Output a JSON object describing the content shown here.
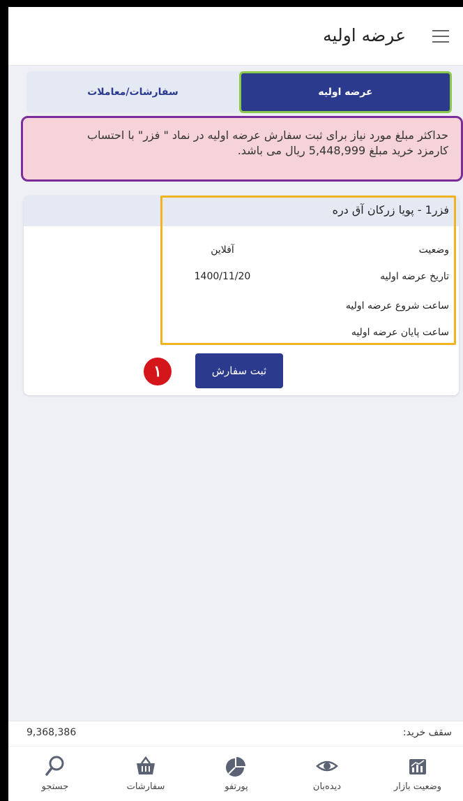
{
  "header": {
    "title": "عرضه اولیه",
    "menu_icon": "hamburger-menu-icon"
  },
  "tabs": [
    {
      "label": "عرضه اولیه",
      "active": true
    },
    {
      "label": "سفارشات/معاملات",
      "active": false
    }
  ],
  "alert": {
    "line1": "حداکثر مبلغ مورد نیاز برای ثبت سفارش عرضه اولیه در نماد \" فزر\" با احتساب",
    "line2": "کارمزد خرید مبلغ 5,448,999 ریال می باشد."
  },
  "offering": {
    "symbol_name": "فزر1  -  پویا زرکان آق دره",
    "rows": [
      {
        "label": "وضعیت",
        "value": "آفلاین"
      },
      {
        "label": "تاریخ عرضه اولیه",
        "value": "1400/11/20"
      },
      {
        "label": "ساعت شروع عرضه اولیه",
        "value": ""
      },
      {
        "label": "ساعت پایان عرضه اولیه",
        "value": ""
      }
    ],
    "submit_label": "ثبت سفارش",
    "step_badge": "١"
  },
  "buy_cap": {
    "label": "سقف خرید:",
    "value": "9,368,386"
  },
  "bottom_nav": [
    {
      "label": "وضعیت بازار",
      "icon": "market-chart-icon"
    },
    {
      "label": "دیده‌بان",
      "icon": "eye-icon"
    },
    {
      "label": "پورتفو",
      "icon": "pie-chart-icon"
    },
    {
      "label": "سفارشات",
      "icon": "basket-icon"
    },
    {
      "label": "جستجو",
      "icon": "search-icon"
    }
  ],
  "colors": {
    "primary": "#2b3a8c",
    "tab_outline": "#8cc94a",
    "alert_bg": "#f6d3d8",
    "alert_outline": "#7a2d9a",
    "card_outline": "#f2b320",
    "badge": "#d4161b"
  }
}
